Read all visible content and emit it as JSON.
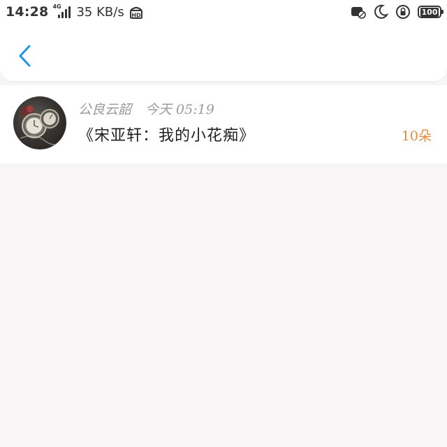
{
  "status_bar": {
    "time": "14:28",
    "network_label": "4G",
    "speed": "35 KB/s",
    "hd_label": "HD",
    "battery": "100"
  },
  "nav": {
    "back_icon": "chevron-left-icon",
    "accent_color": "#1e96e8"
  },
  "item": {
    "author": "公良云韶",
    "time": "今天 05:19",
    "title": "《宋亚轩：我的小花痴》",
    "count": "10朵",
    "count_color": "#e58a3a"
  }
}
